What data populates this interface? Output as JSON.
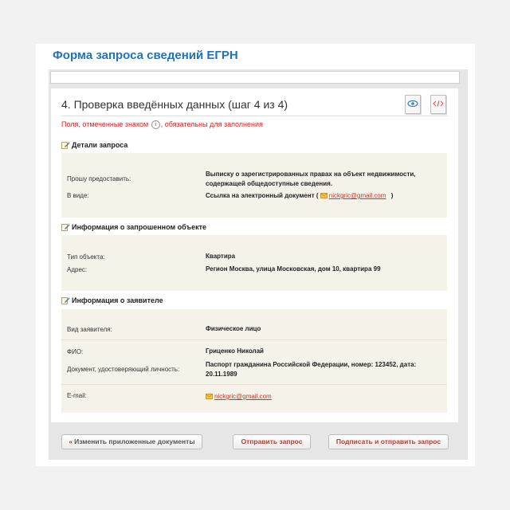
{
  "page_title": "Форма запроса сведений ЕГРН",
  "step_title": "4. Проверка введённых данных (шаг 4 из 4)",
  "required_note": {
    "before": "Поля, отмеченные знаком",
    "mark": "i",
    "after": ", обязательны для заполнения"
  },
  "sections": {
    "request": {
      "title": "Детали запроса",
      "rows": [
        {
          "label": "Прошу предоставить:",
          "value": "Выписку о зарегистрированных правах на объект недвижимости, содержащей общедоступные сведения."
        },
        {
          "label": "В виде:",
          "value": "Ссылка на электронный документ (",
          "email": "nickgric@gmail.com",
          "value_end": ")"
        }
      ]
    },
    "object": {
      "title": "Информация о запрошенном объекте",
      "rows": [
        {
          "label": "Тип объекта:",
          "value": "Квартира"
        },
        {
          "label": "Адрес:",
          "value": "Регион Москва, улица Московская, дом 10, квартира 99"
        }
      ]
    },
    "applicant": {
      "title": "Информация о заявителе",
      "rows": [
        {
          "label": "Вид заявителя:",
          "value": "Физическое лицо"
        },
        {
          "label": "ФИО:",
          "value": "Гриценко Николай"
        },
        {
          "label": "Документ, удостоверяющий личность:",
          "value": "Паспорт гражданина Российской Федерации, номер: 123452, дата: 20.11.1989"
        },
        {
          "label": "E-mail:",
          "email": "nickgric@gmail.com"
        }
      ]
    }
  },
  "buttons": {
    "back_chevron": "«",
    "back": "Изменить приложенные документы",
    "send": "Отправить запрос",
    "sign_send": "Подписать и отправить запрос"
  },
  "icons": [
    "preview-icon",
    "xml-code-icon",
    "section-edit-icon",
    "envelope-icon"
  ],
  "colors": {
    "title_blue": "#1e73be",
    "accent_red": "#c0392b",
    "section_bg": "#f5f2ea"
  }
}
